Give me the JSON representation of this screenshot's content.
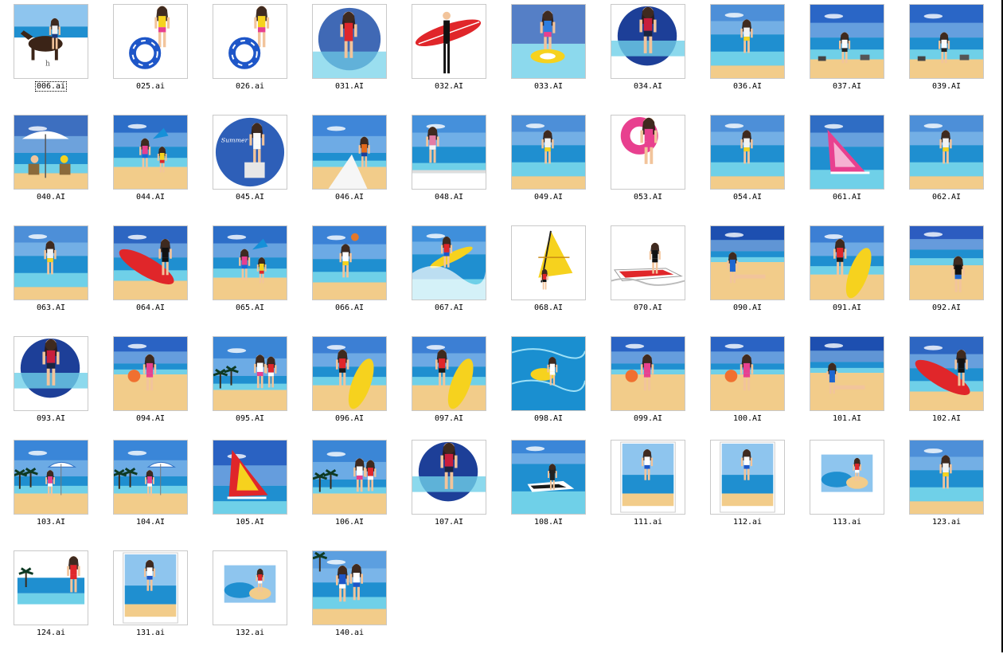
{
  "window": {
    "view": "thumbnails"
  },
  "selected_index": 0,
  "files": [
    {
      "name": "006.ai",
      "scene": "horse"
    },
    {
      "name": "025.ai",
      "scene": "ring-girl"
    },
    {
      "name": "026.ai",
      "scene": "ring-girl"
    },
    {
      "name": "031.AI",
      "scene": "bikini-sea"
    },
    {
      "name": "032.AI",
      "scene": "surfboard-red"
    },
    {
      "name": "033.AI",
      "scene": "float-girl"
    },
    {
      "name": "034.AI",
      "scene": "girl-sea"
    },
    {
      "name": "036.AI",
      "scene": "beach-man"
    },
    {
      "name": "037.AI",
      "scene": "beach-laptop"
    },
    {
      "name": "039.AI",
      "scene": "beach-laptop"
    },
    {
      "name": "040.AI",
      "scene": "umbrella"
    },
    {
      "name": "044.AI",
      "scene": "beach-kids"
    },
    {
      "name": "045.AI",
      "scene": "circle"
    },
    {
      "name": "046.AI",
      "scene": "beach-sit"
    },
    {
      "name": "048.AI",
      "scene": "beach-rail"
    },
    {
      "name": "049.AI",
      "scene": "beach-man"
    },
    {
      "name": "053.AI",
      "scene": "pink-circle"
    },
    {
      "name": "054.AI",
      "scene": "beach-man"
    },
    {
      "name": "061.AI",
      "scene": "windsurf-pink"
    },
    {
      "name": "062.AI",
      "scene": "beach-man"
    },
    {
      "name": "063.AI",
      "scene": "beach-man"
    },
    {
      "name": "064.AI",
      "scene": "surfboard-red-bg"
    },
    {
      "name": "065.AI",
      "scene": "beach-kids"
    },
    {
      "name": "066.AI",
      "scene": "volley"
    },
    {
      "name": "067.AI",
      "scene": "surfing"
    },
    {
      "name": "068.AI",
      "scene": "windsurf-yellow"
    },
    {
      "name": "070.AI",
      "scene": "jetski"
    },
    {
      "name": "090.AI",
      "scene": "sand-lie"
    },
    {
      "name": "091.AI",
      "scene": "surfboard-yellow"
    },
    {
      "name": "092.AI",
      "scene": "sand-sit"
    },
    {
      "name": "093.AI",
      "scene": "girl-sea"
    },
    {
      "name": "094.AI",
      "scene": "sand-girl"
    },
    {
      "name": "095.AI",
      "scene": "palms"
    },
    {
      "name": "096.AI",
      "scene": "surfboard-yellow"
    },
    {
      "name": "097.AI",
      "scene": "surfboard-yellow"
    },
    {
      "name": "098.AI",
      "scene": "pool"
    },
    {
      "name": "099.AI",
      "scene": "sand-girl"
    },
    {
      "name": "100.AI",
      "scene": "sand-girl"
    },
    {
      "name": "101.AI",
      "scene": "sand-lie"
    },
    {
      "name": "102.AI",
      "scene": "surfboard-red-bg"
    },
    {
      "name": "103.AI",
      "scene": "palms-umbrella"
    },
    {
      "name": "104.AI",
      "scene": "palms-umbrella"
    },
    {
      "name": "105.AI",
      "scene": "windsurf-stripe"
    },
    {
      "name": "106.AI",
      "scene": "palms"
    },
    {
      "name": "107.AI",
      "scene": "girl-sea"
    },
    {
      "name": "108.AI",
      "scene": "jetski-sea"
    },
    {
      "name": "111.ai",
      "scene": "poster"
    },
    {
      "name": "112.ai",
      "scene": "poster"
    },
    {
      "name": "113.ai",
      "scene": "small-beach"
    },
    {
      "name": "123.ai",
      "scene": "beach-man"
    },
    {
      "name": "124.ai",
      "scene": "island"
    },
    {
      "name": "131.ai",
      "scene": "poster"
    },
    {
      "name": "132.ai",
      "scene": "small-beach"
    },
    {
      "name": "140.ai",
      "scene": "couple"
    }
  ],
  "colors": {
    "sky": "#2f6fc4",
    "sky_light": "#8ec5ee",
    "sea": "#1f8fd0",
    "sea_light": "#6fd0e8",
    "sand": "#f2cc8a",
    "red": "#e0262a",
    "yellow": "#f6d21e",
    "pink": "#e8408f",
    "skin": "#f2c49b",
    "hair": "#2b1a12"
  }
}
